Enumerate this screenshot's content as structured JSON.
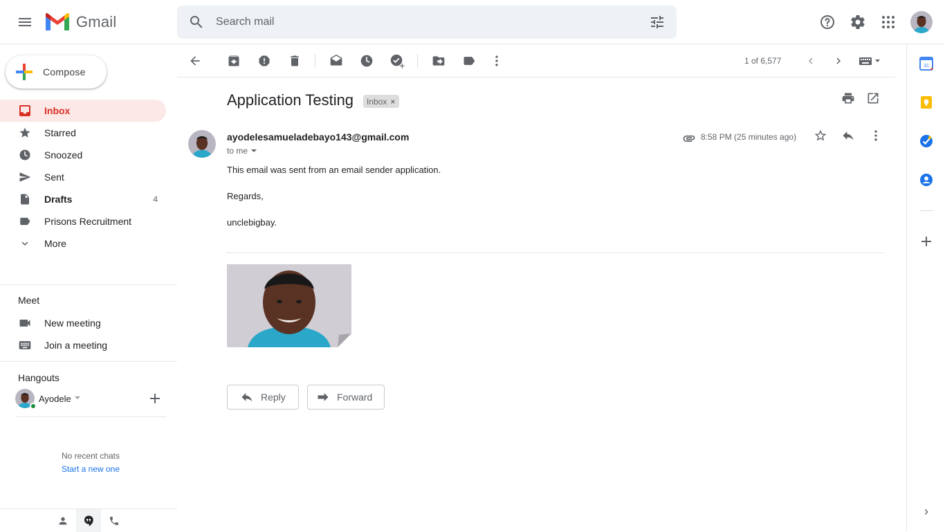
{
  "app": {
    "name": "Gmail"
  },
  "search": {
    "placeholder": "Search mail",
    "value": ""
  },
  "compose": {
    "label": "Compose"
  },
  "nav": [
    {
      "label": "Inbox",
      "icon": "inbox-icon",
      "count": "",
      "active": true
    },
    {
      "label": "Starred",
      "icon": "star-icon",
      "count": ""
    },
    {
      "label": "Snoozed",
      "icon": "clock-icon",
      "count": ""
    },
    {
      "label": "Sent",
      "icon": "send-icon",
      "count": ""
    },
    {
      "label": "Drafts",
      "icon": "draft-icon",
      "count": "4",
      "bold": true
    },
    {
      "label": "Prisons Recruitment",
      "icon": "label-icon",
      "count": ""
    },
    {
      "label": "More",
      "icon": "chevron-down-icon",
      "count": ""
    }
  ],
  "meet": {
    "title": "Meet",
    "new_meeting": "New meeting",
    "join_meeting": "Join a meeting"
  },
  "hangouts": {
    "title": "Hangouts",
    "user": "Ayodele",
    "no_chats": "No recent chats",
    "start_new": "Start a new one"
  },
  "toolbar": {
    "pager": "1 of 6,577"
  },
  "message": {
    "subject": "Application Testing",
    "label": "Inbox",
    "sender": "ayodelesamueladebayo143@gmail.com",
    "to": "to me",
    "time": "8:58 PM (25 minutes ago)",
    "body": [
      "This email was sent from an email sender application.",
      "Regards,",
      "unclebigbay."
    ]
  },
  "actions": {
    "reply": "Reply",
    "forward": "Forward"
  },
  "colors": {
    "accent_red": "#d93025",
    "active_bg": "#fce8e6",
    "link_blue": "#1a73e8",
    "search_bg": "#eef1f5",
    "online_green": "#1e8e3e"
  }
}
